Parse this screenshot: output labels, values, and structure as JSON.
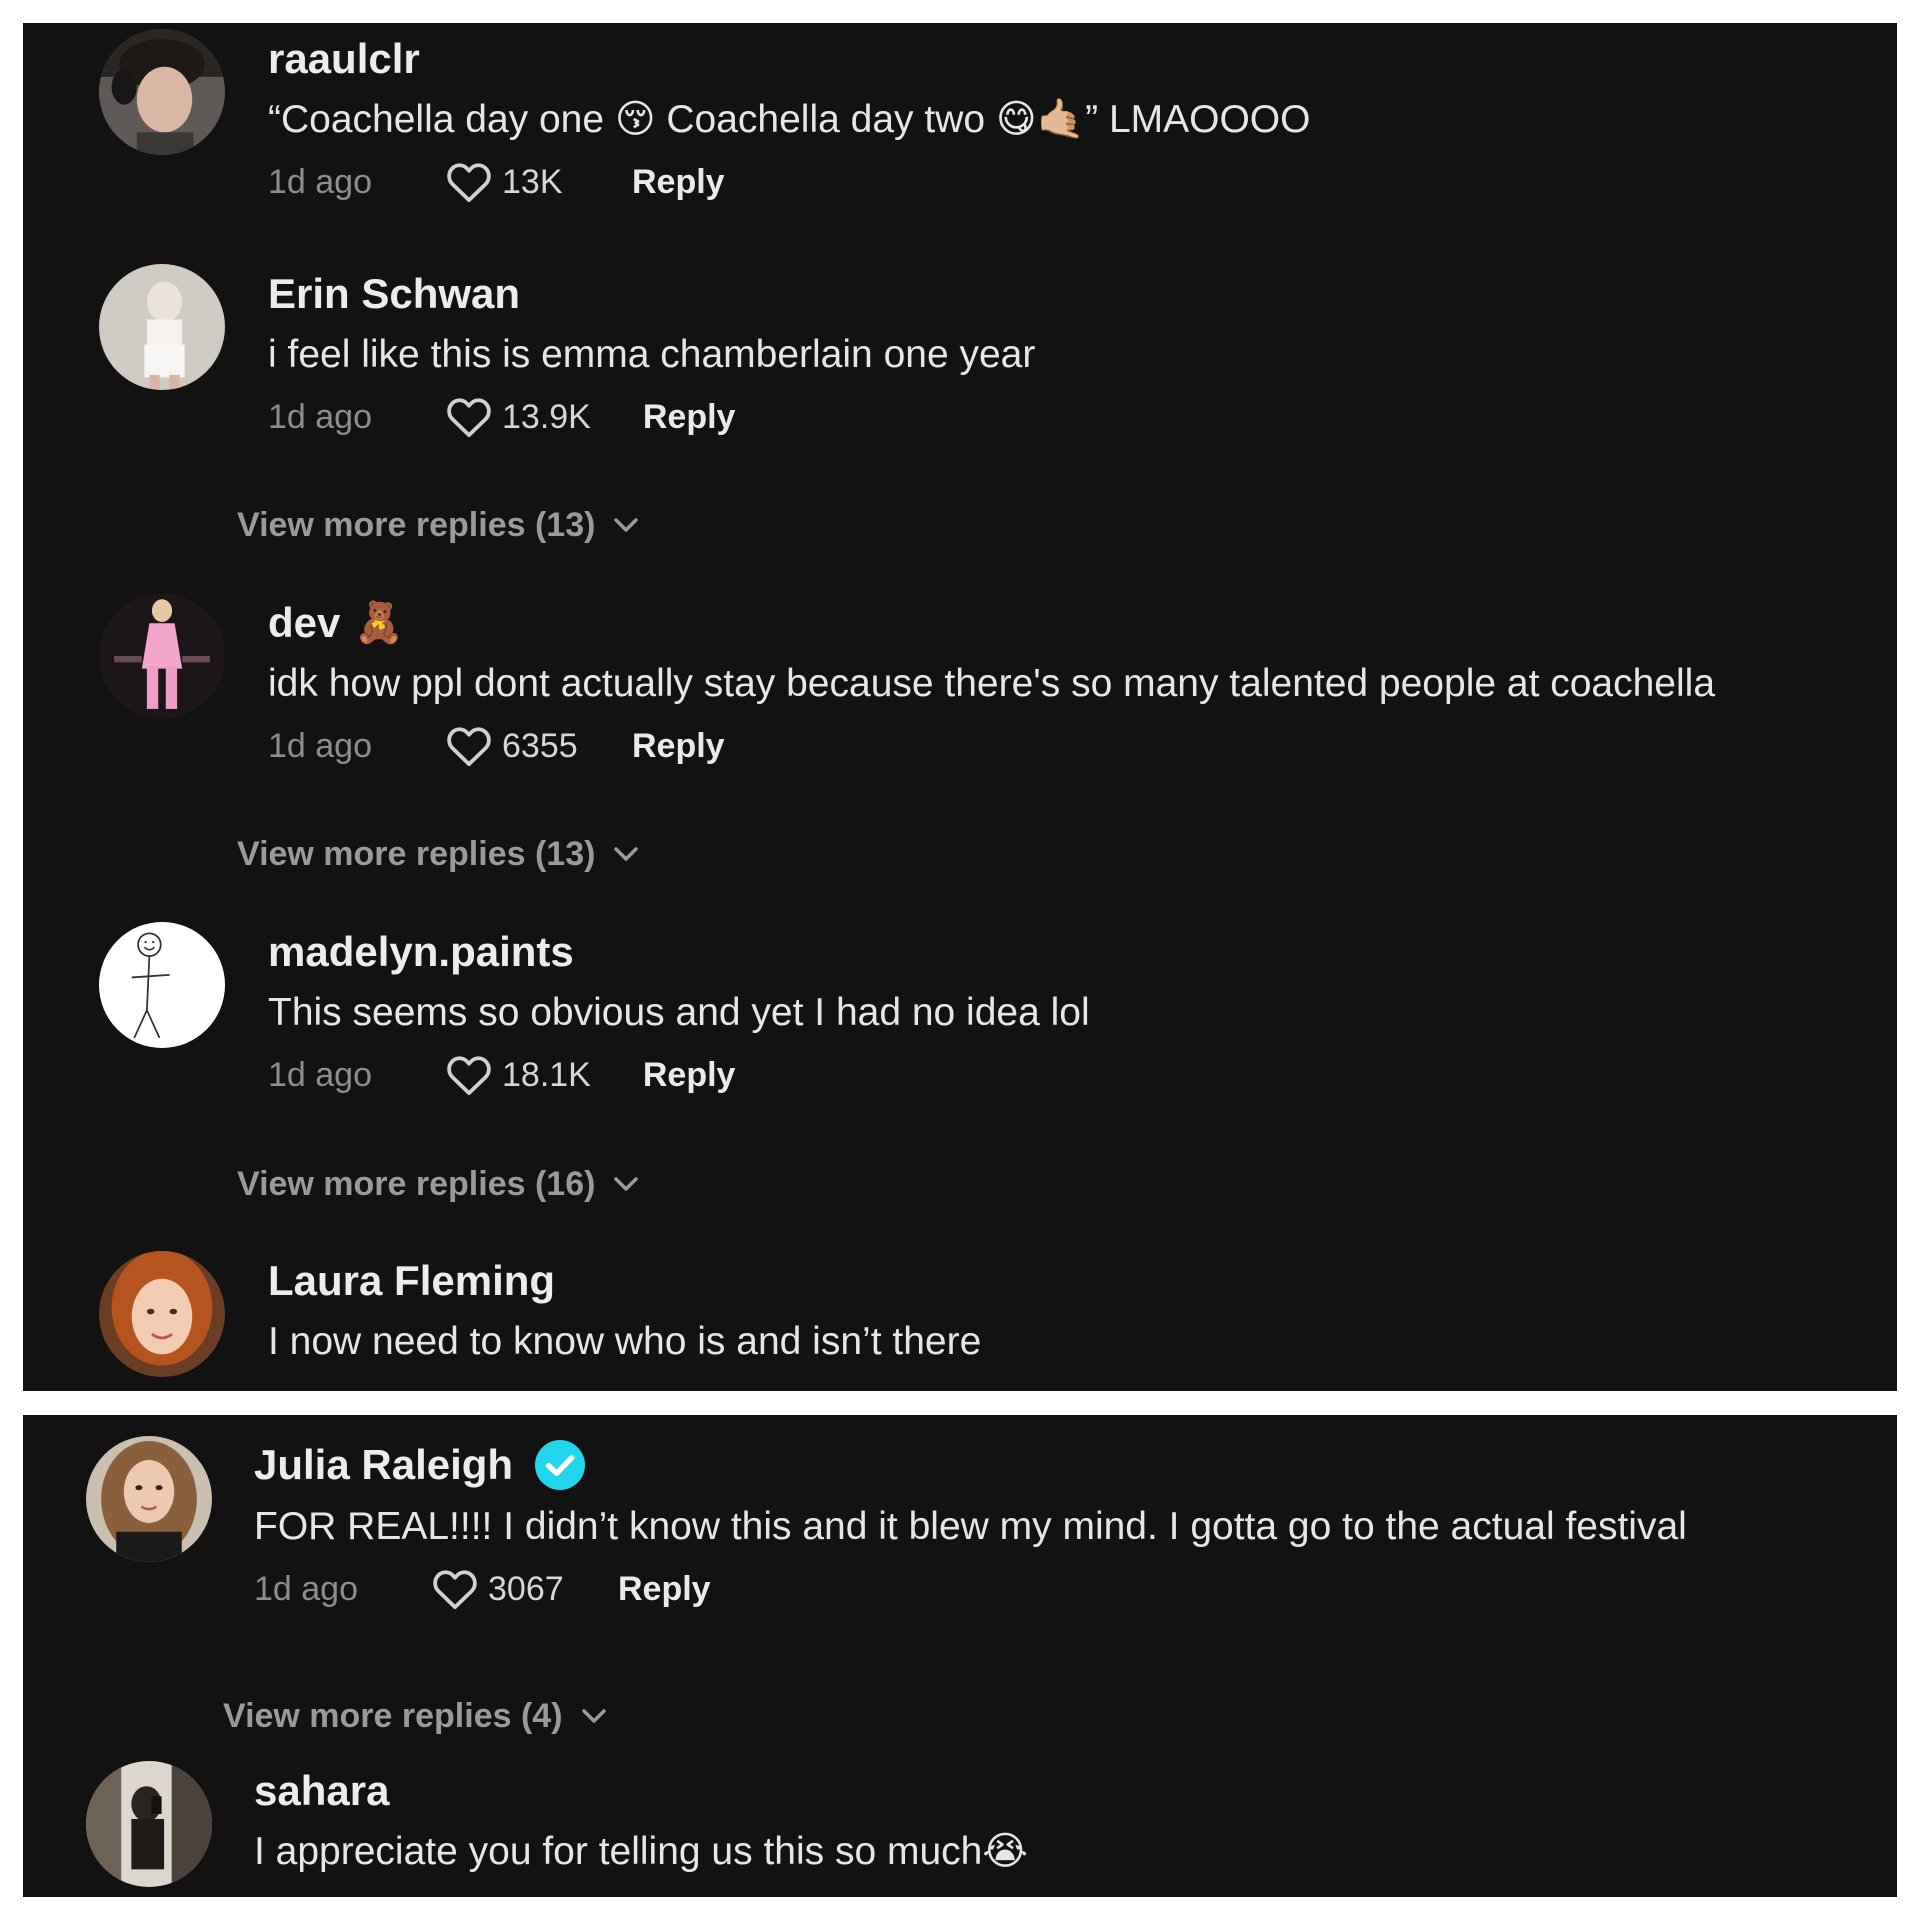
{
  "colors": {
    "panel_background": "#121212",
    "username": "#ececec",
    "comment_text": "#e6e6e6",
    "muted_text": "#8d8d8d",
    "verified_badge": "#20d5ec"
  },
  "panel_1": {
    "comments": [
      {
        "username": "raaulclr",
        "text": "“Coachella day one 😚 Coachella day two 😋🤙🏼” LMAOOOO",
        "time": "1d ago",
        "likes": "13K",
        "reply_label": "Reply"
      },
      {
        "username": "Erin Schwan",
        "text": "i feel like this is emma chamberlain one year",
        "time": "1d ago",
        "likes": "13.9K",
        "reply_label": "Reply",
        "view_more": "View more replies (13)"
      },
      {
        "username": "dev",
        "username_suffix": "🧸",
        "text": "idk how ppl dont actually stay because there's so many talented people at coachella",
        "time": "1d ago",
        "likes": "6355",
        "reply_label": "Reply",
        "view_more": "View more replies (13)"
      },
      {
        "username": "madelyn.paints",
        "text": "This seems so obvious and yet I had no idea lol",
        "time": "1d ago",
        "likes": "18.1K",
        "reply_label": "Reply",
        "view_more": "View more replies (16)"
      },
      {
        "username": "Laura Fleming",
        "text": "I now need to know who is and isn’t there"
      }
    ]
  },
  "panel_2": {
    "comments": [
      {
        "username": "Julia Raleigh",
        "verified": true,
        "text": "FOR REAL!!!! I didn’t know this and it blew my mind. I gotta go to the actual festival",
        "time": "1d ago",
        "likes": "3067",
        "reply_label": "Reply",
        "view_more": "View more replies (4)"
      },
      {
        "username": "sahara",
        "text": "I appreciate you for telling us this so much😭"
      }
    ]
  }
}
